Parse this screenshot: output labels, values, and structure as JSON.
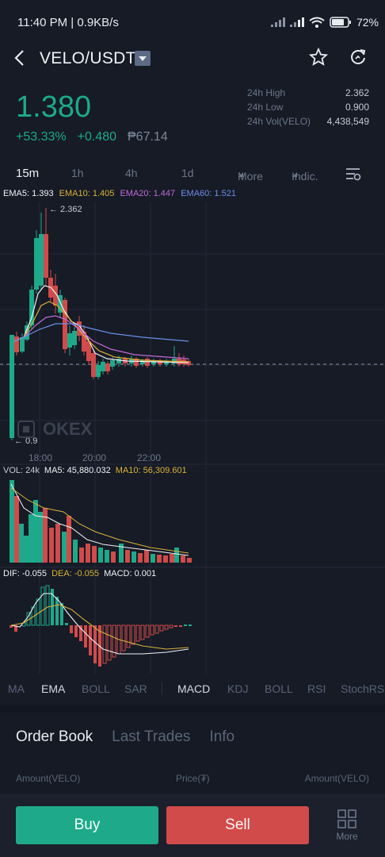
{
  "status": {
    "time": "11:40 PM | 0.9KB/s",
    "battery": "72"
  },
  "header": {
    "pair": "VELO/USDT"
  },
  "ticker": {
    "price": "1.380",
    "change_pct": "+53.33%",
    "change_abs": "+0.480",
    "fiat": "₱67.14",
    "high_label": "24h High",
    "high": "2.362",
    "low_label": "24h Low",
    "low": "0.900",
    "vol_label": "24h Vol(VELO)",
    "vol": "4,438,549"
  },
  "timeframes": [
    "15m",
    "1h",
    "4h",
    "1d",
    "More",
    "Indic."
  ],
  "main_indicators": {
    "ema5": "EMA5: 1.393",
    "ema10": "EMA10: 1.405",
    "ema20": "EMA20: 1.447",
    "ema60": "EMA60: 1.521",
    "high_mark": "← 2.362",
    "low_mark": "← 0.9"
  },
  "time_axis": [
    "18:00",
    "20:00",
    "22:00"
  ],
  "volume_indicators": {
    "vol": "VOL: 24k",
    "ma5": "MA5: 45,880.032",
    "ma10": "MA10: 56,309.601"
  },
  "macd_indicators": {
    "dif": "DIF: -0.055",
    "dea": "DEA: -0.055",
    "macd": "MACD: 0.001"
  },
  "watermark": "OKEX",
  "indicator_tabs": [
    "MA",
    "EMA",
    "BOLL",
    "SAR",
    "MACD",
    "KDJ",
    "BOLL",
    "RSI",
    "StochRSI"
  ],
  "orderbook": {
    "tabs": [
      "Order Book",
      "Last Trades",
      "Info"
    ],
    "col_left": "Amount(VELO)",
    "col_mid": "Price(₮)",
    "col_right": "Amount(VELO)"
  },
  "actions": {
    "buy": "Buy",
    "sell": "Sell",
    "more": "More"
  },
  "colors": {
    "up": "#1ea98a",
    "down": "#d14b4b",
    "ema5": "#f0f2f6",
    "ema10": "#d8b23a",
    "ema20": "#c06ad6",
    "ema60": "#6d8ee8"
  }
}
